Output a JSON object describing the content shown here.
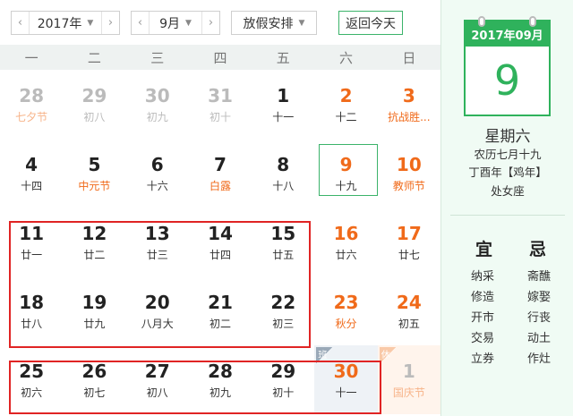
{
  "toolbar": {
    "year": "2017年",
    "month": "9月",
    "holiday_select": "放假安排",
    "today_button": "返回今天"
  },
  "week_headers": [
    "一",
    "二",
    "三",
    "四",
    "五",
    "六",
    "日"
  ],
  "weeks": [
    [
      {
        "d": "28",
        "s": "七夕节",
        "other": true,
        "fest": true
      },
      {
        "d": "29",
        "s": "初八",
        "other": true
      },
      {
        "d": "30",
        "s": "初九",
        "other": true
      },
      {
        "d": "31",
        "s": "初十",
        "other": true
      },
      {
        "d": "1",
        "s": "十一"
      },
      {
        "d": "2",
        "s": "十二",
        "weekend": true
      },
      {
        "d": "3",
        "s": "抗战胜...",
        "weekend": true,
        "fest": true
      }
    ],
    [
      {
        "d": "4",
        "s": "十四"
      },
      {
        "d": "5",
        "s": "中元节",
        "fest": true
      },
      {
        "d": "6",
        "s": "十六"
      },
      {
        "d": "7",
        "s": "白露",
        "fest": true
      },
      {
        "d": "8",
        "s": "十八"
      },
      {
        "d": "9",
        "s": "十九",
        "weekend": true,
        "selected": true
      },
      {
        "d": "10",
        "s": "教师节",
        "weekend": true,
        "fest": true
      }
    ],
    [
      {
        "d": "11",
        "s": "廿一"
      },
      {
        "d": "12",
        "s": "廿二"
      },
      {
        "d": "13",
        "s": "廿三"
      },
      {
        "d": "14",
        "s": "廿四"
      },
      {
        "d": "15",
        "s": "廿五"
      },
      {
        "d": "16",
        "s": "廿六",
        "weekend": true
      },
      {
        "d": "17",
        "s": "廿七",
        "weekend": true
      }
    ],
    [
      {
        "d": "18",
        "s": "廿八"
      },
      {
        "d": "19",
        "s": "廿九"
      },
      {
        "d": "20",
        "s": "八月大"
      },
      {
        "d": "21",
        "s": "初二"
      },
      {
        "d": "22",
        "s": "初三"
      },
      {
        "d": "23",
        "s": "秋分",
        "weekend": true,
        "fest": true
      },
      {
        "d": "24",
        "s": "初五",
        "weekend": true
      }
    ],
    [
      {
        "d": "25",
        "s": "初六"
      },
      {
        "d": "26",
        "s": "初七"
      },
      {
        "d": "27",
        "s": "初八"
      },
      {
        "d": "28",
        "s": "初九"
      },
      {
        "d": "29",
        "s": "初十"
      },
      {
        "d": "30",
        "s": "十一",
        "weekend": true,
        "badge": "班",
        "badgeType": "ban"
      },
      {
        "d": "1",
        "s": "国庆节",
        "other": true,
        "fest": true,
        "badge": "休",
        "badgeType": "xiu"
      }
    ]
  ],
  "detail": {
    "card_header": "2017年09月",
    "card_day": "9",
    "weekday": "星期六",
    "lunar": "农历七月十九",
    "ganzhi": "丁酉年【鸡年】",
    "zodiac": "处女座",
    "yi_title": "宜",
    "ji_title": "忌",
    "yi": [
      "纳采",
      "修造",
      "开市",
      "交易",
      "立券"
    ],
    "ji": [
      "斋醮",
      "嫁娶",
      "行丧",
      "动土",
      "作灶"
    ]
  },
  "colors": {
    "accent_green": "#2fb25c",
    "weekend_orange": "#f06a1a",
    "highlight_red": "#e02424"
  }
}
